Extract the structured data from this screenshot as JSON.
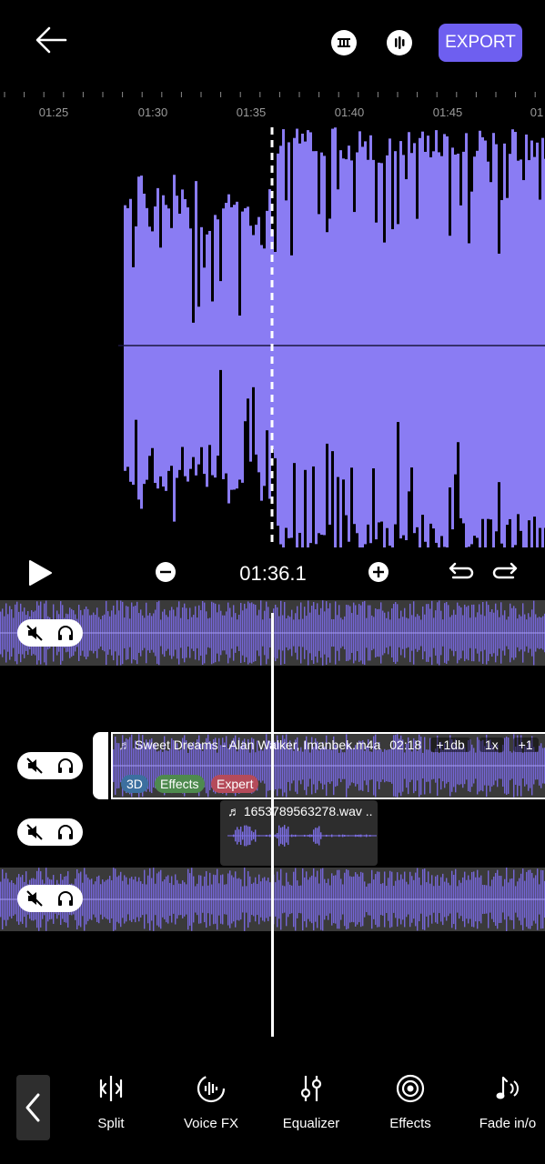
{
  "header": {
    "export_label": "EXPORT"
  },
  "ruler": {
    "labels": [
      "01:25",
      "01:30",
      "01:35",
      "01:40",
      "01:45",
      "01"
    ]
  },
  "transport": {
    "current_time": "01:36.1"
  },
  "tracks": [
    {
      "name": "track-1",
      "clip_title": "Sweet Dreams - Alan Walker, Imanbek.m4a",
      "clip_duration": "02:18",
      "clip_gain": "+1db",
      "clip_speed": "1x",
      "clip_extra": "+1",
      "tags": [
        "3D",
        "Effects",
        "Expert"
      ]
    },
    {
      "name": "track-2",
      "clip_title": "1653789563278.wav .."
    }
  ],
  "toolbar": {
    "items": [
      {
        "label": "Split",
        "icon": "split-icon"
      },
      {
        "label": "Voice FX",
        "icon": "voice-fx-icon"
      },
      {
        "label": "Equalizer",
        "icon": "equalizer-icon"
      },
      {
        "label": "Effects",
        "icon": "effects-icon"
      },
      {
        "label": "Fade in/o",
        "icon": "fade-icon"
      }
    ]
  },
  "colors": {
    "accent": "#6e5ff0",
    "waveform": "#8a7cf3",
    "track_waveform": "#7566d8",
    "tag_3d": "#3c6f9f",
    "tag_effects": "#4e8a4e",
    "tag_expert": "#b54b5a"
  }
}
